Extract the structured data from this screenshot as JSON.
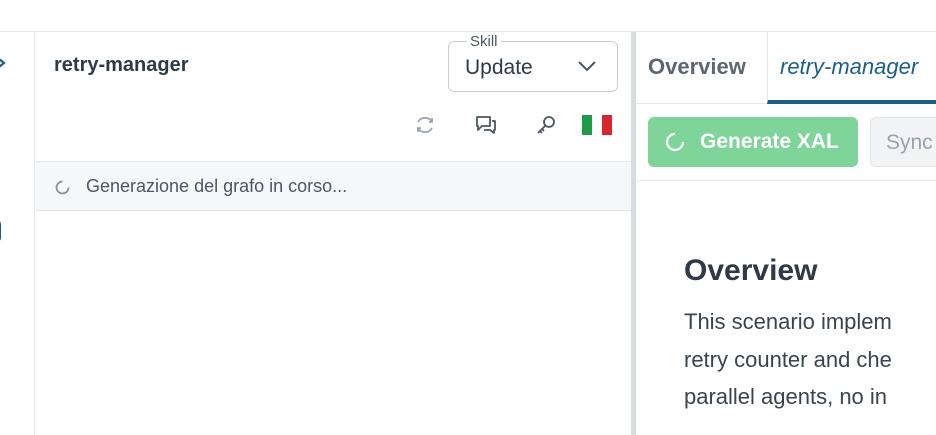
{
  "panel": {
    "title": "retry-manager"
  },
  "skill": {
    "legend": "Skill",
    "value": "Update"
  },
  "status": {
    "text": "Generazione del grafo in corso..."
  },
  "tabs": [
    {
      "label": "Overview"
    },
    {
      "label": "retry-manager"
    }
  ],
  "actions": {
    "generate_label": "Generate XAL",
    "sync_label": "Sync"
  },
  "overview": {
    "heading": "Overview",
    "lines": [
      "This scenario implem",
      "retry counter and che",
      "parallel agents, no in"
    ]
  },
  "colors": {
    "accent": "#1c5f86",
    "generate_button": "#7fd49a",
    "flag_green": "#1f9a48",
    "flag_white": "#ffffff",
    "flag_red": "#d8262c"
  },
  "icons": [
    "refresh-icon",
    "chat-icon",
    "key-icon",
    "italian-flag-icon",
    "spinner-icon",
    "chevron-down-icon"
  ]
}
